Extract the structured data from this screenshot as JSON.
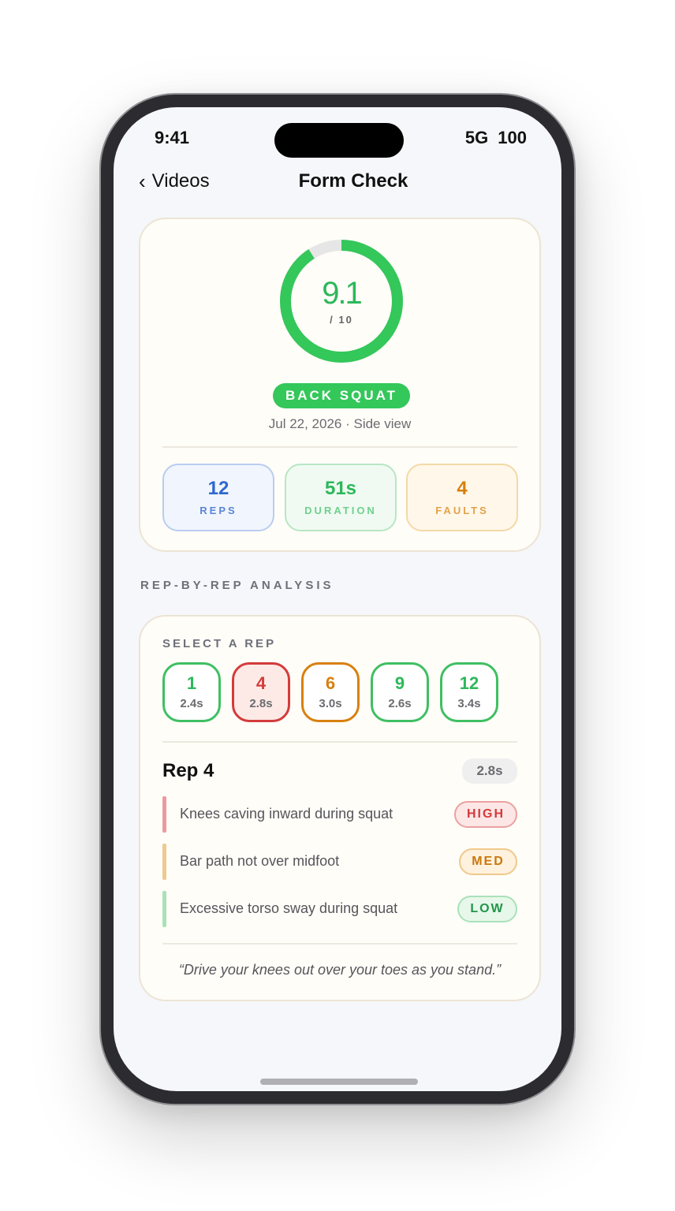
{
  "status": {
    "time": "9:41",
    "network": "5G",
    "battery": "100"
  },
  "nav": {
    "back_label": "Videos",
    "title": "Form Check"
  },
  "summary": {
    "score": "9.1",
    "score_max": "/ 10",
    "score_fraction": 0.91,
    "exercise": "BACK SQUAT",
    "meta": "Jul 22, 2026 · Side view",
    "stats": {
      "reps": {
        "value": "12",
        "label": "REPS"
      },
      "duration": {
        "value": "51s",
        "label": "DURATION"
      },
      "faults": {
        "value": "4",
        "label": "FAULTS"
      }
    }
  },
  "section_label": "REP-BY-REP ANALYSIS",
  "rep_selector": {
    "label": "SELECT A REP",
    "reps": [
      {
        "number": "1",
        "time": "2.4s",
        "status": "green"
      },
      {
        "number": "4",
        "time": "2.8s",
        "status": "red"
      },
      {
        "number": "6",
        "time": "3.0s",
        "status": "orange"
      },
      {
        "number": "9",
        "time": "2.6s",
        "status": "green"
      },
      {
        "number": "12",
        "time": "3.4s",
        "status": "green"
      }
    ]
  },
  "rep_detail": {
    "title": "Rep 4",
    "time": "2.8s",
    "faults": [
      {
        "text": "Knees caving inward during squat",
        "severity": "HIGH"
      },
      {
        "text": "Bar path not over midfoot",
        "severity": "MED"
      },
      {
        "text": "Excessive torso sway during squat",
        "severity": "LOW"
      }
    ],
    "cue": "“Drive your knees out over your toes as you stand.”"
  },
  "colors": {
    "score_ring": "#34c75a",
    "ring_track": "#e6e6e6"
  }
}
